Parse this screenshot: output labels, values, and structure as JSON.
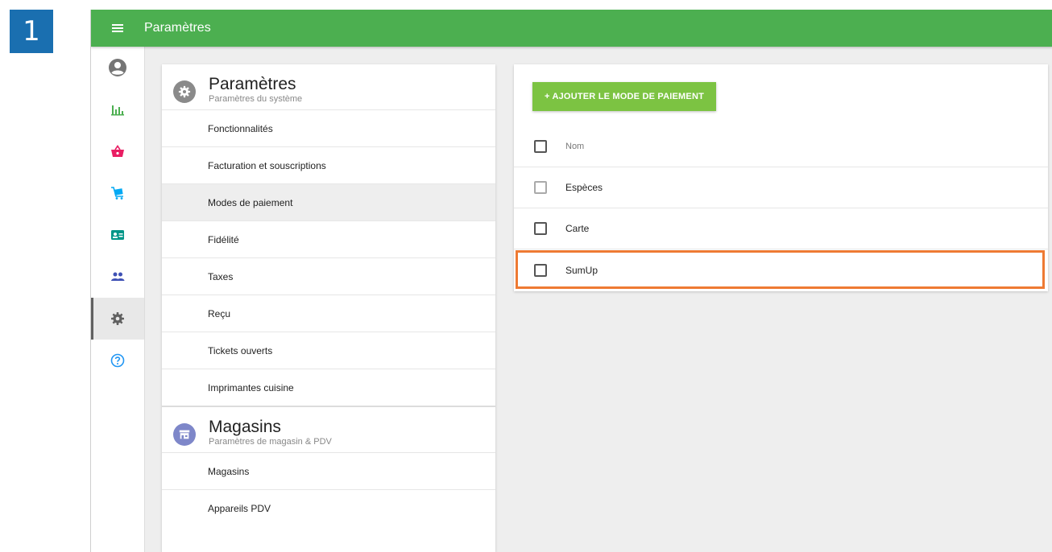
{
  "step_badge": "1",
  "topbar": {
    "title": "Paramètres",
    "menu_icon": "hamburger-menu-icon"
  },
  "leftnav": {
    "items": [
      {
        "name": "account",
        "icon": "account-circle-icon",
        "color": "#757575"
      },
      {
        "name": "reports",
        "icon": "bar-chart-icon",
        "color": "#4caf50"
      },
      {
        "name": "items",
        "icon": "basket-icon",
        "color": "#e91e63"
      },
      {
        "name": "inventory",
        "icon": "cart-icon",
        "color": "#03a9f4"
      },
      {
        "name": "customers",
        "icon": "id-card-icon",
        "color": "#009688"
      },
      {
        "name": "employees",
        "icon": "people-icon",
        "color": "#3f51b5"
      },
      {
        "name": "settings",
        "icon": "gear-icon",
        "color": "#616161",
        "active": true
      },
      {
        "name": "help",
        "icon": "help-icon",
        "color": "#2196f3"
      }
    ]
  },
  "settings": {
    "title": "Paramètres",
    "subtitle": "Paramètres du système",
    "icon_color": "#8a8a8a",
    "items": [
      "Fonctionnalités",
      "Facturation et souscriptions",
      "Modes de paiement",
      "Fidélité",
      "Taxes",
      "Reçu",
      "Tickets ouverts",
      "Imprimantes cuisine"
    ],
    "selected_index": 2
  },
  "stores": {
    "title": "Magasins",
    "subtitle": "Paramètres de magasin & PDV",
    "icon_color": "#7e87c9",
    "items": [
      "Magasins",
      "Appareils PDV"
    ]
  },
  "payment": {
    "add_button": "+ AJOUTER LE MODE DE PAIEMENT",
    "header": "Nom",
    "rows": [
      "Espèces",
      "Carte",
      "SumUp"
    ],
    "highlighted_row": "SumUp",
    "accent": "#7cc342",
    "highlight_color": "#ee7a33"
  }
}
